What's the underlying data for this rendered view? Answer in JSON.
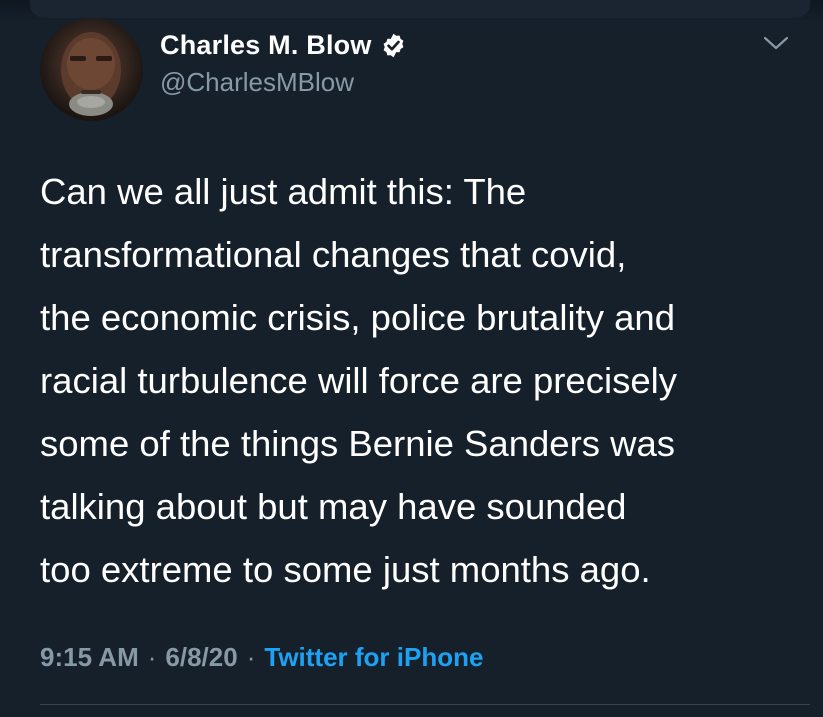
{
  "tweet": {
    "author": {
      "display_name": "Charles M. Blow",
      "handle": "@CharlesMBlow",
      "verified": true
    },
    "text": "Can we all just admit this: The\ntransformational changes that covid,\nthe economic crisis, police brutality and\nracial turbulence will force are precisely\nsome of the things Bernie Sanders was\ntalking about but may have sounded\ntoo extreme to some just months ago.",
    "time": "9:15 AM",
    "date": "6/8/20",
    "source": "Twitter for iPhone",
    "separator": "·"
  },
  "icons": {
    "verified": "verified-badge-icon",
    "more": "chevron-down-icon"
  },
  "colors": {
    "background": "#15202b",
    "text_primary": "#ffffff",
    "text_secondary": "#8899a6",
    "link": "#1da1f2"
  }
}
